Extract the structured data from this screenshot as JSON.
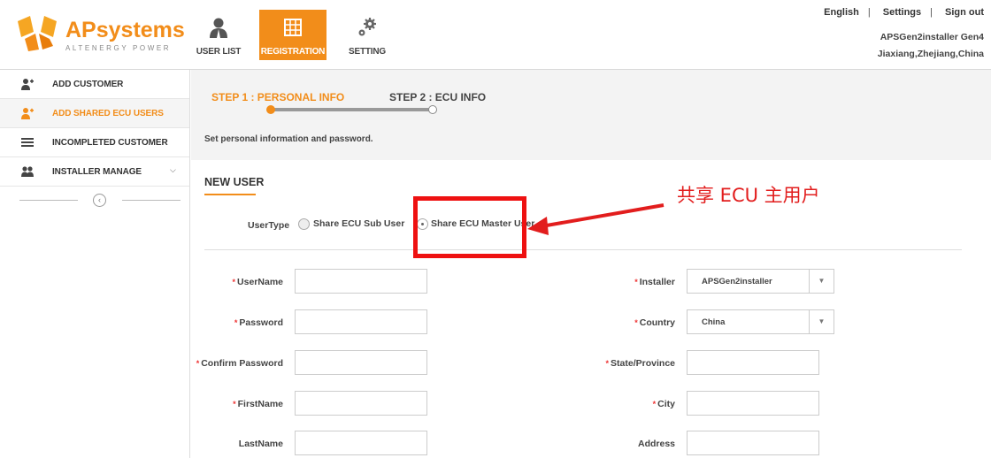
{
  "brand": {
    "name_ap": "AP",
    "name_systems": "systems",
    "tagline": "ALTENERGY POWER",
    "color": "#f28d1a"
  },
  "topnav": [
    {
      "label": "USER LIST",
      "icon": "user-icon",
      "active": false
    },
    {
      "label": "REGISTRATION",
      "icon": "grid-icon",
      "active": true
    },
    {
      "label": "SETTING",
      "icon": "gears-icon",
      "active": false
    }
  ],
  "toplinks": {
    "english": "English",
    "settings": "Settings",
    "signout": "Sign out",
    "separator": "|"
  },
  "user": {
    "name": "APSGen2installer Gen4",
    "location": "Jiaxiang,Zhejiang,China"
  },
  "sidebar": {
    "items": [
      {
        "label": "ADD CUSTOMER",
        "icon": "add-user-icon",
        "active": false
      },
      {
        "label": "ADD SHARED ECU USERS",
        "icon": "add-user-icon",
        "active": true
      },
      {
        "label": "INCOMPLETED CUSTOMER",
        "icon": "list-icon",
        "active": false
      },
      {
        "label": "INSTALLER MANAGE",
        "icon": "users-icon",
        "active": false
      }
    ]
  },
  "steps": {
    "step1": "STEP 1 : PERSONAL INFO",
    "step2": "STEP 2 : ECU INFO",
    "description": "Set personal information and password."
  },
  "form": {
    "section_title": "NEW USER",
    "usertype_label": "UserType",
    "usertype_options": [
      "Share ECU Sub User",
      "Share ECU Master User"
    ],
    "usertype_selected": "Share ECU Master User",
    "left_fields": [
      {
        "label": "UserName",
        "required": "*"
      },
      {
        "label": "Password",
        "required": "*"
      },
      {
        "label": "Confirm Password",
        "required": "*"
      },
      {
        "label": "FirstName",
        "required": "*"
      },
      {
        "label": "LastName",
        "required": ""
      }
    ],
    "right_fields": {
      "installer": {
        "label": "Installer",
        "required": "*",
        "value": "APSGen2installer"
      },
      "country": {
        "label": "Country",
        "required": "*",
        "value": "China"
      },
      "state": {
        "label": "State/Province",
        "required": "*"
      },
      "city": {
        "label": "City",
        "required": "*"
      },
      "address": {
        "label": "Address",
        "required": ""
      }
    }
  },
  "annotation": {
    "text": "共享 ECU 主用户",
    "color": "#e21d1d"
  }
}
